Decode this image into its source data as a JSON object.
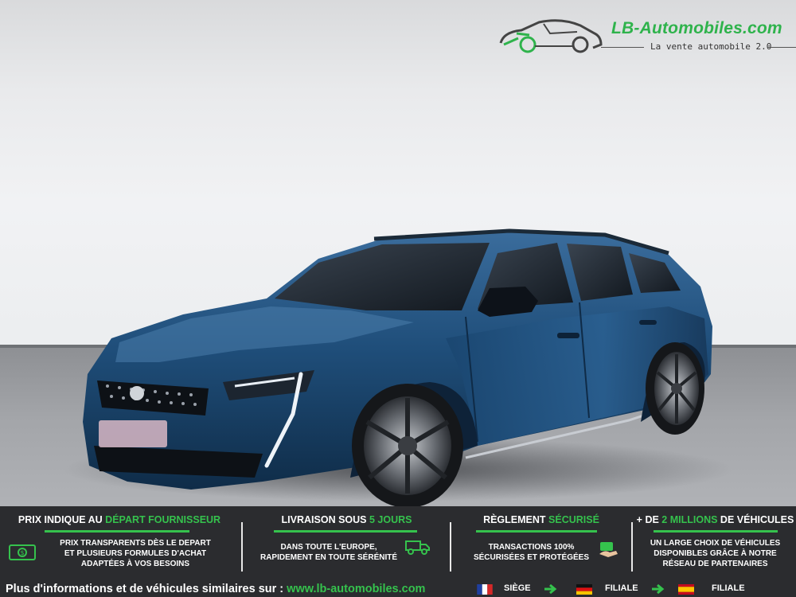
{
  "logo": {
    "name": "LB-Automobiles.com",
    "tagline": "La vente automobile 2.0",
    "icon": "car-logo-icon"
  },
  "photo": {
    "subject": "blue-estate-car",
    "plate_blurred": true
  },
  "features": [
    {
      "title_pre": "PRIX INDIQUE AU ",
      "title_hl": "DÉPART FOURNISSEUR",
      "title_post": "",
      "lines": [
        "PRIX TRANSPARENTS DÈS LE DEPART",
        "ET PLUSIEURS FORMULES D'ACHAT",
        "ADAPTÉES À VOS BESOINS"
      ],
      "icon": "money-icon"
    },
    {
      "title_pre": "LIVRAISON SOUS ",
      "title_hl": "5 JOURS",
      "title_post": "",
      "lines": [
        "DANS TOUTE L'EUROPE,",
        "RAPIDEMENT EN TOUTE SÉRÉNITÉ"
      ],
      "icon": "delivery-truck-icon"
    },
    {
      "title_pre": "RÈGLEMENT ",
      "title_hl": "SÉCURISÉ",
      "title_post": "",
      "lines": [
        "TRANSACTIONS 100%",
        "SÉCURISÉES ET PROTÉGÉES"
      ],
      "icon": "secure-payment-icon"
    },
    {
      "title_pre": "+ DE ",
      "title_hl": "2 MILLIONS",
      "title_post": " DE VÉHICULES",
      "lines": [
        "UN LARGE CHOIX DE VÉHICULES",
        "DISPONIBLES GRÂCE À NOTRE",
        "RÉSEAU DE PARTENAIRES"
      ],
      "icon": ""
    }
  ],
  "footer": {
    "text": "Plus d'informations et de véhicules similaires sur : ",
    "url": "www.lb-automobiles.com",
    "offices": [
      {
        "flag": "france-flag-icon",
        "label": "SIÈGE"
      },
      {
        "flag": "germany-flag-icon",
        "label": "FILIALE"
      },
      {
        "flag": "spain-flag-icon",
        "label": "FILIALE"
      }
    ]
  },
  "colors": {
    "accent_green": "#35c24d",
    "band_bg": "#2b2c2f",
    "car_blue": "#1f4e7a"
  }
}
